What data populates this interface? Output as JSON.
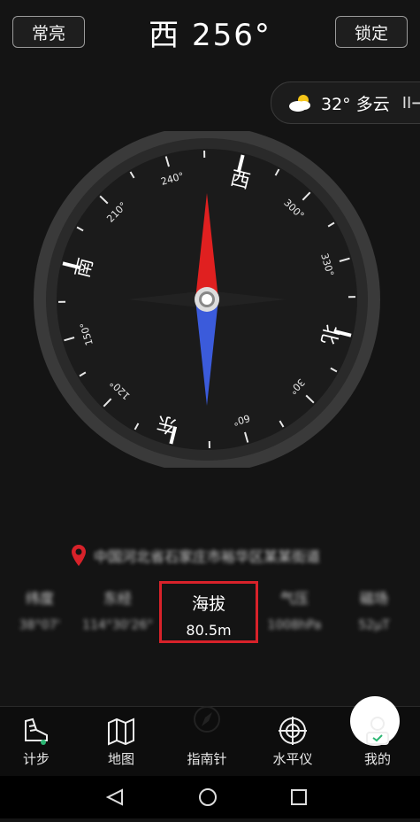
{
  "header": {
    "left_button": "常亮",
    "heading": "西 256°",
    "right_button": "锁定"
  },
  "weather": {
    "text": "32° 多云",
    "icon": "partly-cloudy-icon",
    "action_icon": "collapse-icon",
    "action_label": "II➞"
  },
  "compass": {
    "heading_deg": 256,
    "cardinals": [
      "北",
      "东",
      "南",
      "西"
    ],
    "degree_labels": [
      "30°",
      "60°",
      "120°",
      "150°",
      "210°",
      "240°",
      "300°",
      "330°"
    ]
  },
  "location": {
    "text": "中国河北省石家庄市裕华区某某街道",
    "icon": "map-pin-icon",
    "pin_color": "#d8222a"
  },
  "stats": [
    {
      "label": "纬度",
      "value": "38°07'"
    },
    {
      "label": "东经",
      "value": "114°30'26\""
    },
    {
      "label": "气压",
      "value": "1008hPa"
    },
    {
      "label": "磁场",
      "value": "52μT"
    }
  ],
  "altitude": {
    "label": "海拔",
    "value": "80.5m"
  },
  "nav": [
    {
      "label": "计步",
      "icon": "shoe-icon"
    },
    {
      "label": "地图",
      "icon": "map-icon"
    },
    {
      "label": "指南针",
      "icon": "compass-icon"
    },
    {
      "label": "水平仪",
      "icon": "level-icon"
    },
    {
      "label": "我的",
      "icon": "user-icon"
    }
  ],
  "colors": {
    "accent_red": "#d8222a",
    "needle_north": "#e02020",
    "needle_south": "#3b5bdb"
  }
}
